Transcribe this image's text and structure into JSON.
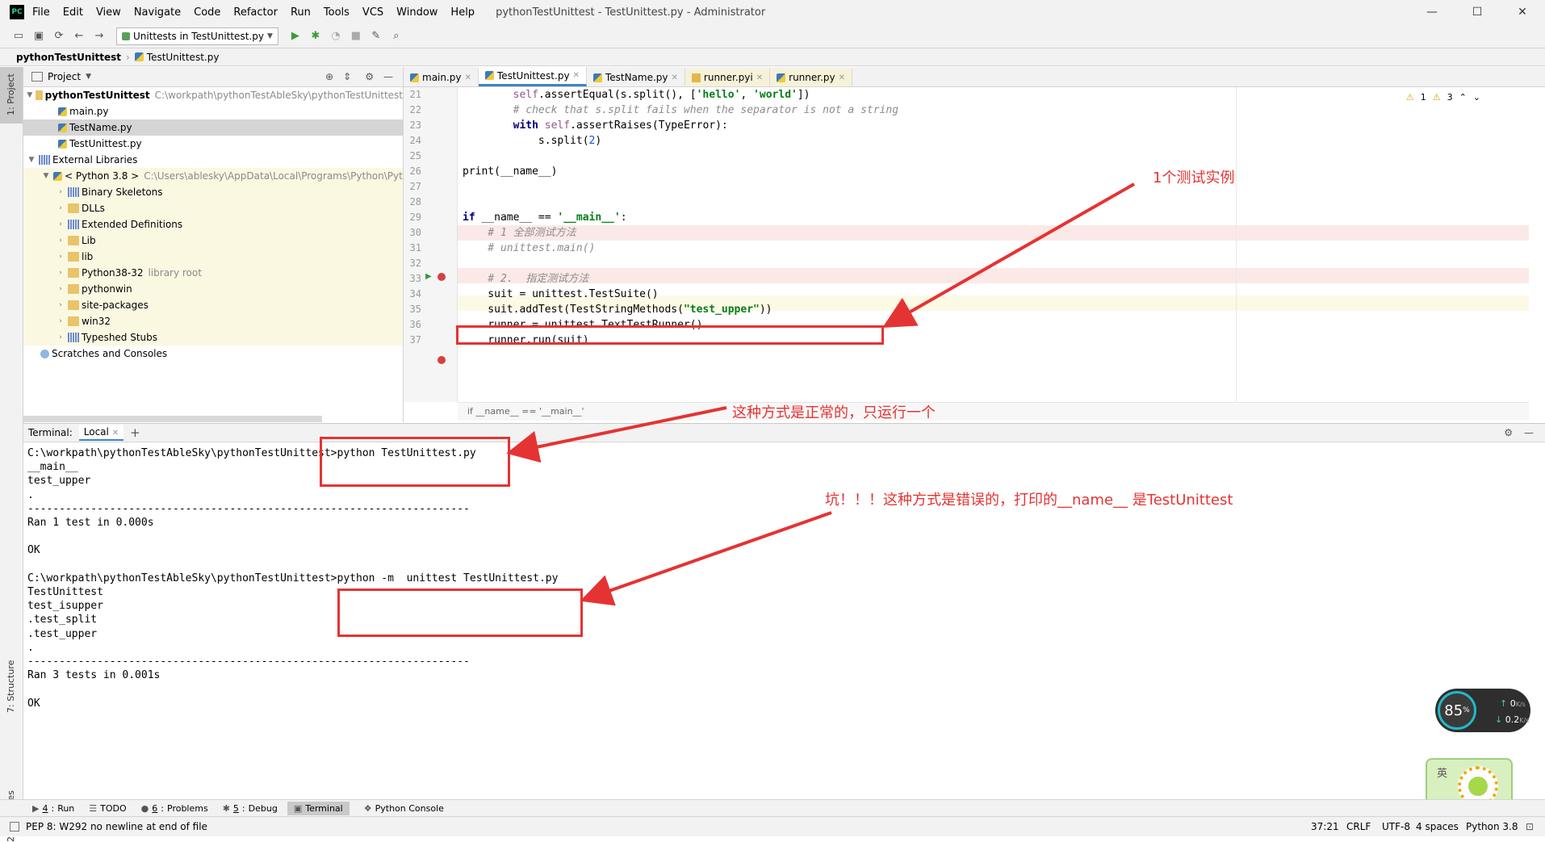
{
  "titlebar": {
    "logo": "PC",
    "menu": [
      "File",
      "Edit",
      "View",
      "Navigate",
      "Code",
      "Refactor",
      "Run",
      "Tools",
      "VCS",
      "Window",
      "Help"
    ],
    "window_title": "pythonTestUnittest - TestUnittest.py - Administrator",
    "min": "—",
    "max": "☐",
    "close": "✕"
  },
  "toolbar": {
    "run_config": "Unittests in TestUnittest.py"
  },
  "breadcrumb": {
    "project": "pythonTestUnittest",
    "file": "TestUnittest.py"
  },
  "left_stripe": {
    "project_label": "1: Project",
    "structure_label": "7: Structure",
    "favorites_label": "2: Favorites"
  },
  "project_panel": {
    "title": "Project",
    "root_name": "pythonTestUnittest",
    "root_path": "C:\\workpath\\pythonTestAbleSky\\pythonTestUnittest",
    "files": [
      "main.py",
      "TestName.py",
      "TestUnittest.py"
    ],
    "external_libraries": "External Libraries",
    "python_sdk": "< Python 3.8 >",
    "python_path": "C:\\Users\\ablesky\\AppData\\Local\\Programs\\Python\\Pyt",
    "lib_items": [
      {
        "name": "Binary Skeletons",
        "hint": ""
      },
      {
        "name": "DLLs",
        "hint": ""
      },
      {
        "name": "Extended Definitions",
        "hint": ""
      },
      {
        "name": "Lib",
        "hint": ""
      },
      {
        "name": "lib",
        "hint": ""
      },
      {
        "name": "Python38-32",
        "hint": "library root"
      },
      {
        "name": "pythonwin",
        "hint": ""
      },
      {
        "name": "site-packages",
        "hint": ""
      },
      {
        "name": "win32",
        "hint": ""
      },
      {
        "name": "Typeshed Stubs",
        "hint": ""
      }
    ],
    "scratches": "Scratches and Consoles"
  },
  "editor": {
    "tabs": [
      "main.py",
      "TestUnittest.py",
      "TestName.py",
      "runner.pyi",
      "runner.py"
    ],
    "active_tab": "TestUnittest.py",
    "inspection": {
      "warnings": "1",
      "weak_warnings": "3"
    },
    "line_numbers": [
      "21",
      "22",
      "23",
      "24",
      "25",
      "26",
      "27",
      "28",
      "29",
      "30",
      "31",
      "32",
      "33",
      "34",
      "35",
      "36",
      "37"
    ],
    "footer_breadcrumb": "if __name__ == '__main__'"
  },
  "terminal": {
    "title": "Terminal:",
    "tab": "Local",
    "lines": [
      "C:\\workpath\\pythonTestAbleSky\\pythonTestUnittest>python TestUnittest.py",
      "__main__",
      "test_upper",
      ".",
      "----------------------------------------------------------------------",
      "Ran 1 test in 0.000s",
      "",
      "OK",
      "",
      "C:\\workpath\\pythonTestAbleSky\\pythonTestUnittest>python -m  unittest TestUnittest.py",
      "TestUnittest",
      "test_isupper",
      ".test_split",
      ".test_upper",
      ".",
      "----------------------------------------------------------------------",
      "Ran 3 tests in 0.001s",
      "",
      "OK"
    ]
  },
  "annotations": {
    "one_instance": "1个测试实例",
    "normal_way": "这种方式是正常的，只运行一个",
    "wrong_way": "坑！！！这种方式是错误的，打印的__name__ 是TestUnittest"
  },
  "tool_windows": [
    {
      "key": "4",
      "label": "Run",
      "icon": "▶"
    },
    {
      "key": "",
      "label": "TODO",
      "icon": "☰"
    },
    {
      "key": "6",
      "label": "Problems",
      "icon": "❶"
    },
    {
      "key": "5",
      "label": "Debug",
      "icon": "✱"
    },
    {
      "key": "",
      "label": "Terminal",
      "icon": "▣"
    },
    {
      "key": "",
      "label": "Python Console",
      "icon": "❖"
    }
  ],
  "statusbar": {
    "message": "PEP 8: W292 no newline at end of file",
    "position": "37:21",
    "line_sep": "CRLF",
    "encoding": "UTF-8",
    "indent": "4 spaces",
    "interpreter": "Python 3.8"
  },
  "net_widget": {
    "cpu": "85",
    "cpu_unit": "%",
    "up": "0",
    "down": "0.2",
    "unit": "K/s"
  },
  "ime_widget": {
    "label": "英"
  }
}
